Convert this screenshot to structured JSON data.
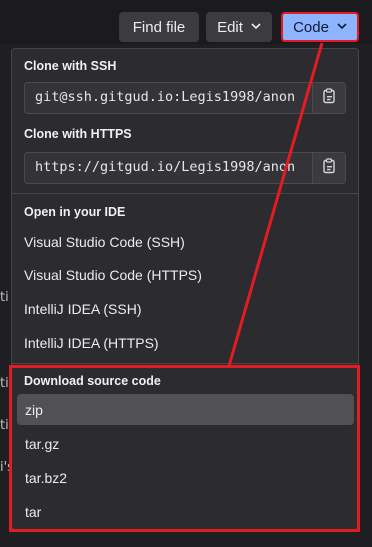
{
  "toolbar": {
    "find_file": "Find file",
    "edit": "Edit",
    "code": "Code"
  },
  "background": {
    "fragments": [
      "ti",
      "ti",
      "ti",
      "i's"
    ]
  },
  "dropdown": {
    "ssh": {
      "title": "Clone with SSH",
      "url": "git@ssh.gitgud.io:Legis1998/anon"
    },
    "https": {
      "title": "Clone with HTTPS",
      "url": "https://gitgud.io/Legis1998/anon"
    },
    "ide": {
      "title": "Open in your IDE",
      "items": [
        "Visual Studio Code (SSH)",
        "Visual Studio Code (HTTPS)",
        "IntelliJ IDEA (SSH)",
        "IntelliJ IDEA (HTTPS)"
      ]
    },
    "download": {
      "title": "Download source code",
      "items": [
        "zip",
        "tar.gz",
        "tar.bz2",
        "tar"
      ]
    }
  },
  "icons": {
    "chevron": "chevron-down-icon",
    "copy": "clipboard-icon"
  },
  "colors": {
    "annotation": "#e51b23",
    "code_button": "#8fb4ff"
  }
}
